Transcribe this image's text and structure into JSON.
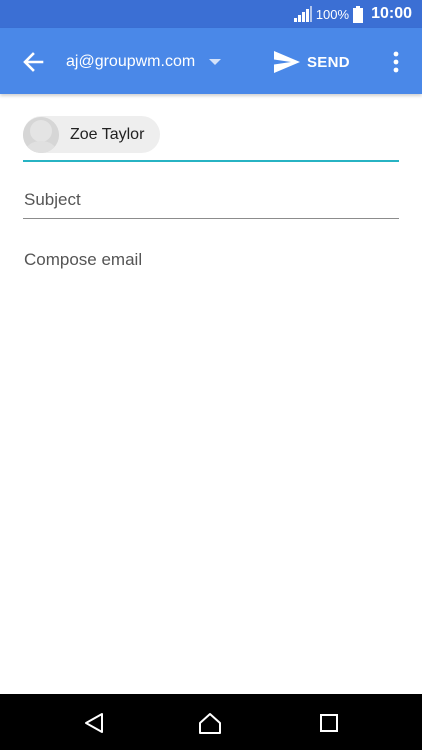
{
  "status_bar": {
    "battery_percent": "100%",
    "time": "10:00",
    "icons": [
      "signal-icon",
      "battery-icon"
    ]
  },
  "toolbar": {
    "back_icon": "back-arrow-icon",
    "account": "aj@groupwm.com",
    "dropdown_icon": "dropdown-triangle-icon",
    "send_icon": "send-icon",
    "send_label": "SEND",
    "more_icon": "more-vert-icon"
  },
  "compose": {
    "recipients": [
      {
        "name": "Zoe Taylor"
      }
    ],
    "subject_placeholder": "Subject",
    "body_placeholder": "Compose email"
  },
  "nav_bar": {
    "icons": [
      "nav-back-icon",
      "nav-home-icon",
      "nav-recents-icon"
    ]
  },
  "colors": {
    "status_bar": "#3b6fd4",
    "toolbar": "#4a88e8",
    "field_focus": "#27b3c3",
    "text_muted": "#555555"
  }
}
